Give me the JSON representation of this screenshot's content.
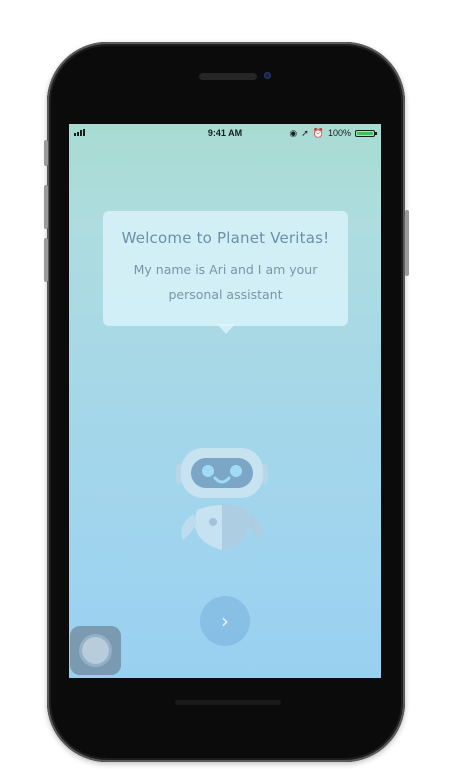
{
  "status_bar": {
    "time": "9:41 AM",
    "battery_percent": "100%",
    "icons": [
      "signal-icon",
      "lock-rotation-icon",
      "location-icon",
      "alarm-icon",
      "battery-icon"
    ]
  },
  "welcome": {
    "title": "Welcome to Planet Veritas!",
    "body_line_1": "My name is Ari and I am your",
    "body_line_2": "personal assistant"
  },
  "next_button": {
    "icon": "chevron-right-icon",
    "glyph": "›"
  },
  "colors": {
    "screen_top": "#a8dcd2",
    "screen_bottom": "#99d0f0",
    "bubble": "#e0f6fd",
    "text": "#6d8fa7",
    "battery": "#3fc15a"
  }
}
